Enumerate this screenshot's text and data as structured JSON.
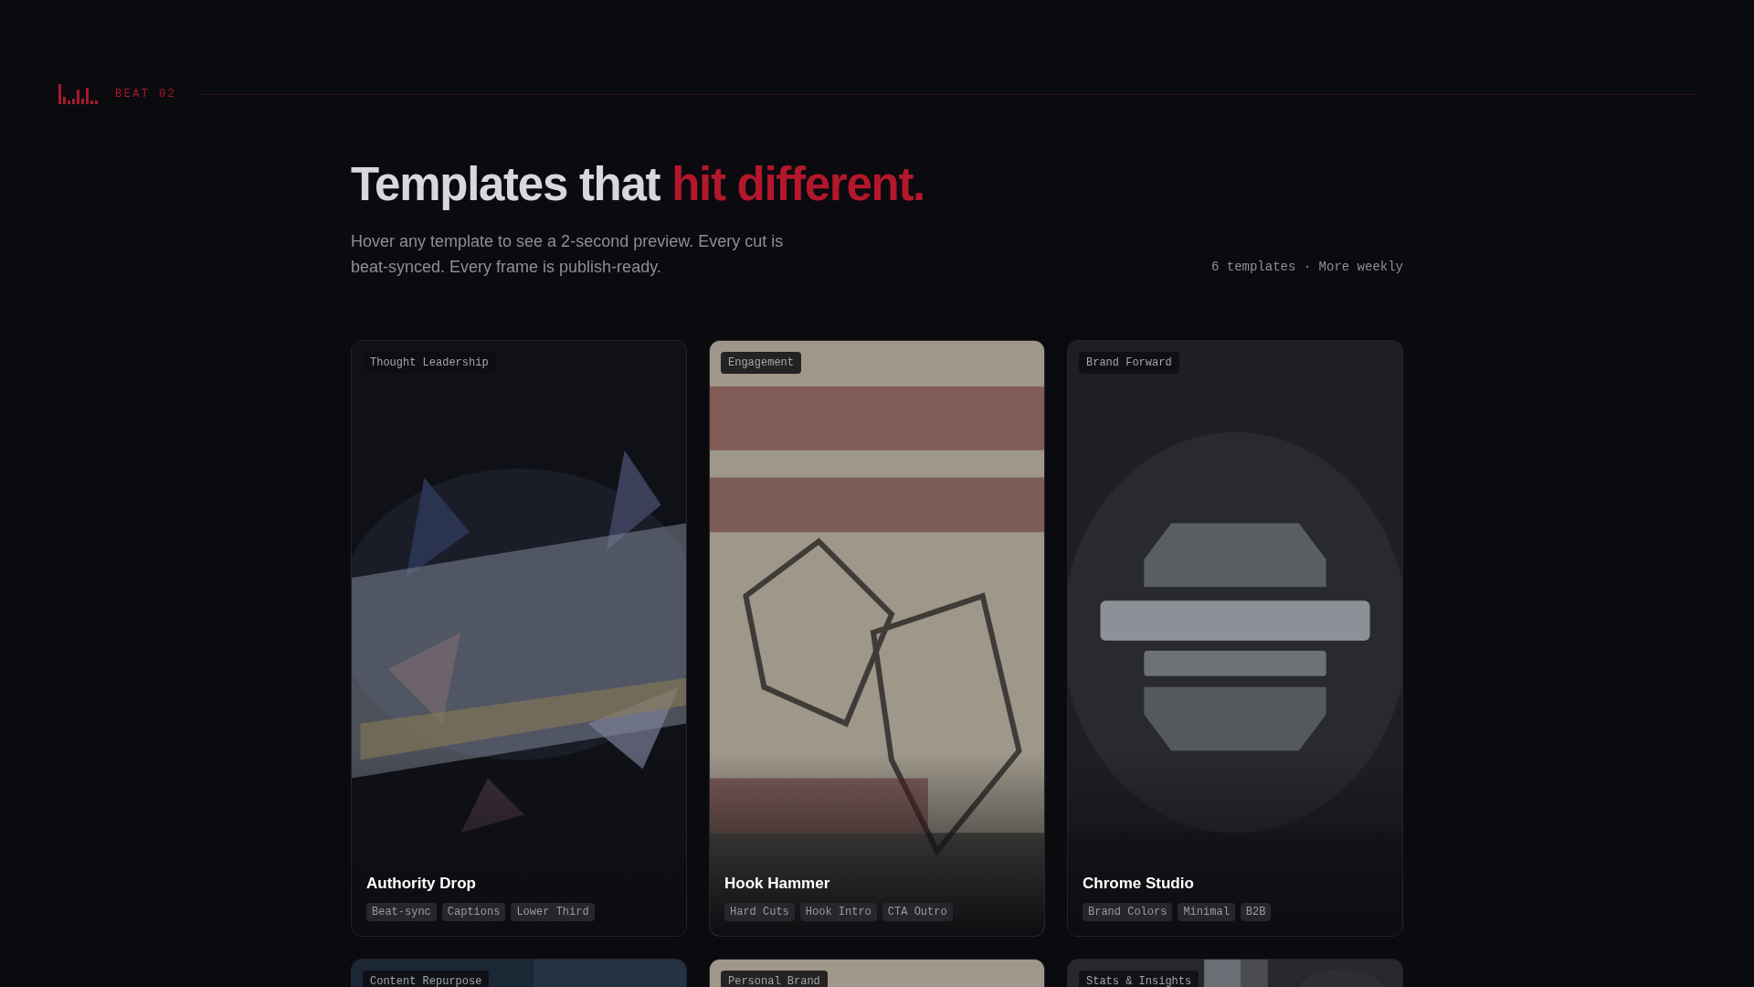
{
  "brand": {
    "label": "BEAT 02"
  },
  "heading": {
    "lead": "Templates that",
    "accent": "hit different."
  },
  "intro": "Hover any template to see a 2-second preview. Every cut is beat-synced. Every frame is publish-ready.",
  "meta": "6 templates · More weekly",
  "templates": [
    {
      "category": "Thought Leadership",
      "title": "Authority Drop",
      "tags": [
        "Beat-sync",
        "Captions",
        "Lower Third"
      ],
      "picture": {
        "kind": "shards"
      }
    },
    {
      "category": "Engagement",
      "title": "Hook Hammer",
      "tags": [
        "Hard Cuts",
        "Hook Intro",
        "CTA Outro"
      ],
      "picture": {
        "kind": "paper"
      }
    },
    {
      "category": "Brand Forward",
      "title": "Chrome Studio",
      "tags": [
        "Brand Colors",
        "Minimal",
        "B2B"
      ],
      "picture": {
        "kind": "chrome"
      }
    },
    {
      "category": "Content Repurpose",
      "picture": {
        "kind": "navy"
      }
    },
    {
      "category": "Personal Brand",
      "picture": {
        "kind": "paper"
      }
    },
    {
      "category": "Stats & Insights",
      "picture": {
        "kind": "light"
      }
    }
  ]
}
